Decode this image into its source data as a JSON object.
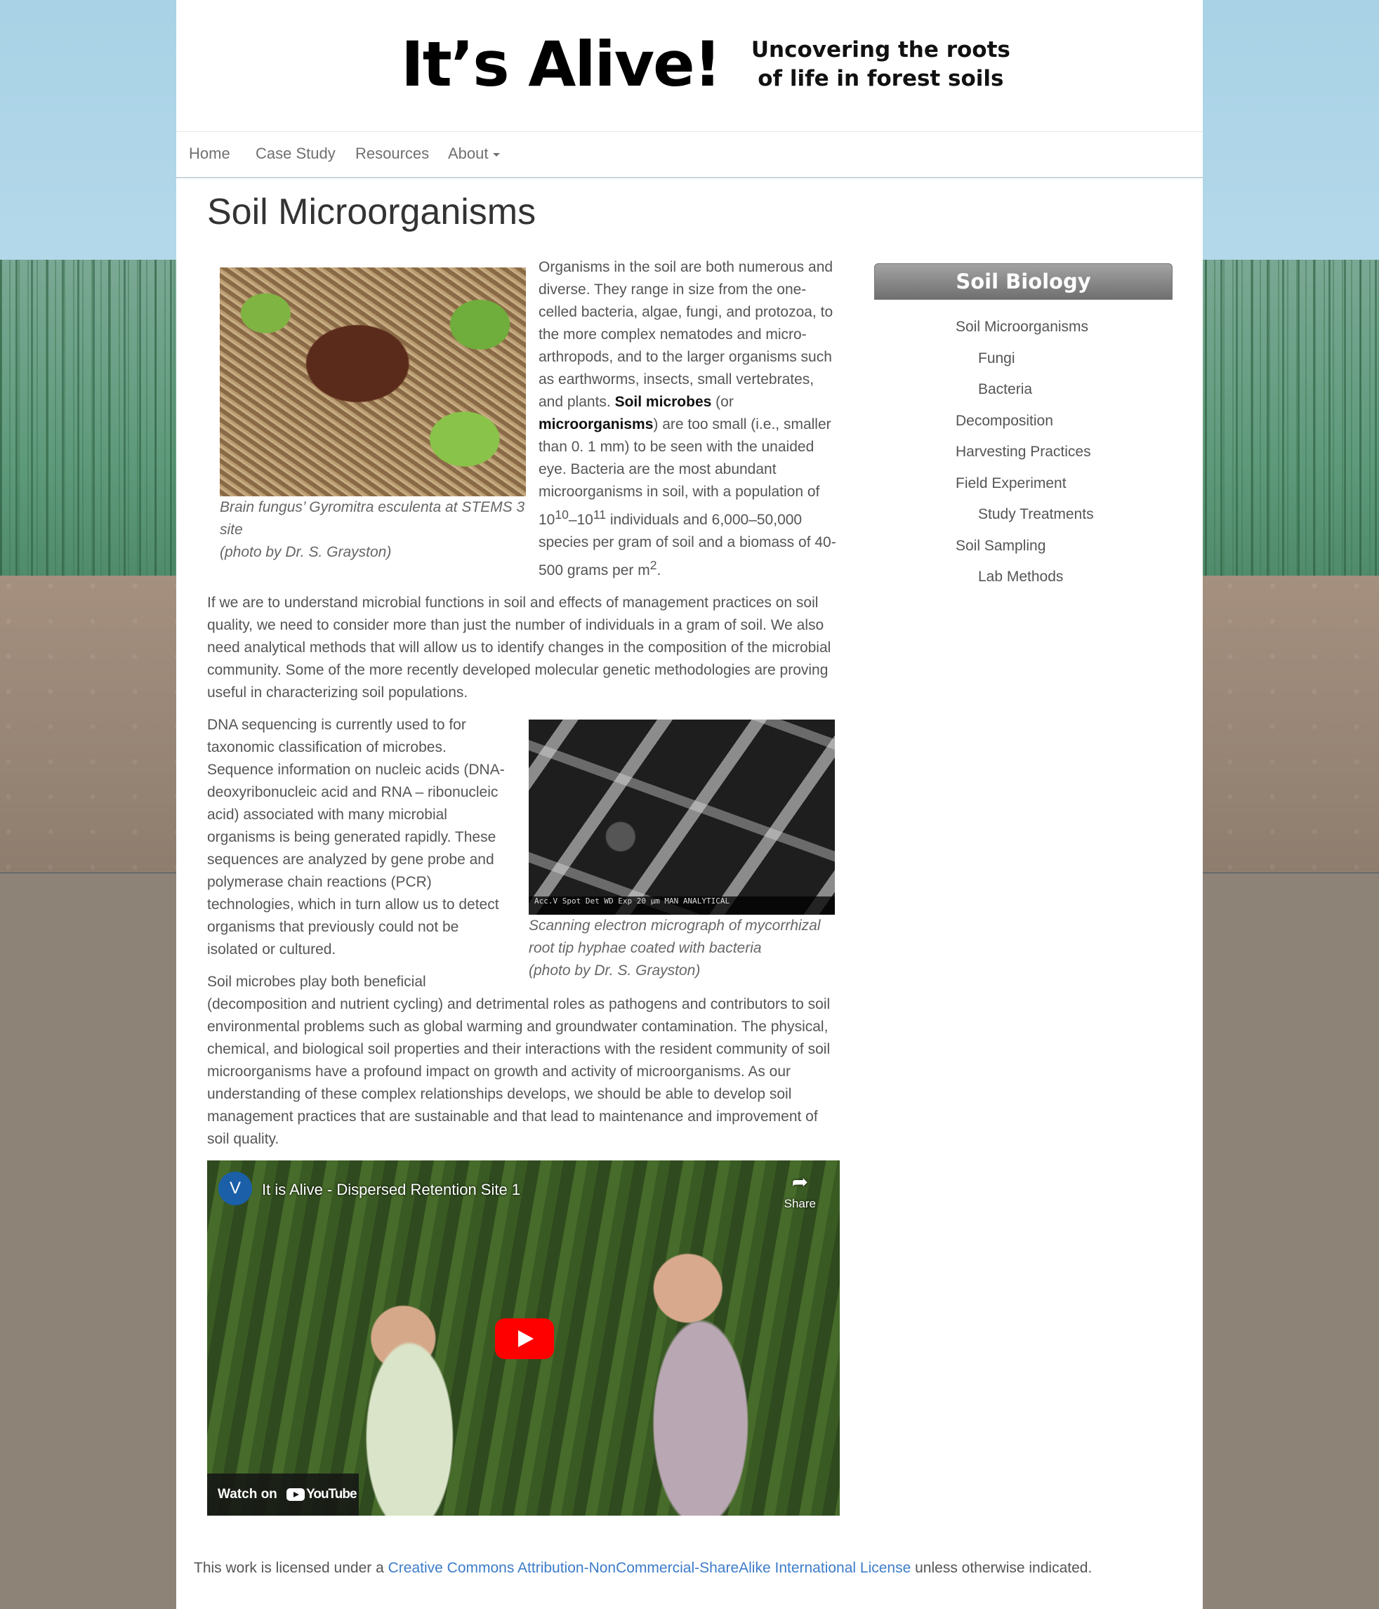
{
  "banner": {
    "title": "It’s Alive!",
    "tagline_line1": "Uncovering the roots",
    "tagline_line2": "of life in forest soils"
  },
  "nav": {
    "items": [
      {
        "label": "Home"
      },
      {
        "label": "Case Study"
      },
      {
        "label": "Resources"
      },
      {
        "label": "About"
      }
    ]
  },
  "page": {
    "title": "Soil Microorganisms"
  },
  "figures": {
    "morel": {
      "caption_line1": "Brain fungus’ Gyromitra esculenta at STEMS 3 site",
      "caption_line2": "(photo by Dr. S. Grayston)"
    },
    "sem": {
      "caption_line1": "Scanning electron micrograph of mycorrhizal root tip hyphae coated with bacteria",
      "caption_line2": "(photo by Dr. S. Grayston)",
      "overlay_text": "Acc.V  Spot Det  WD  Exp    20 μm    MAN ANALYTICAL"
    }
  },
  "article": {
    "p1_a": "Organisms in the soil are both numerous and diverse. They range in size from the one-celled bacteria, algae, fungi, and protozoa, to the more complex nematodes and micro-arthropods, and to the larger organisms such as earthworms, insects, small vertebrates, and plants.",
    "p1_bold1": "Soil microbes",
    "p1_b": "(or",
    "p1_bold2": "microorganisms",
    "p1_c": ") are too small (i.e., smaller than 0. 1 mm) to be seen with the unaided eye. Bacteria are the most abundant microorganisms in soil, with a population of 10",
    "p1_sup1": "10",
    "p1_d": "–10",
    "p1_sup2": "11",
    "p1_e": " individuals and 6,000–50,000 species per gram of soil and a biomass of 40-500 grams per m",
    "p1_sup3": "2",
    "p1_f": ".",
    "p2": "If we are to understand microbial functions in soil and effects of management practices on soil quality, we need to consider more than just the number of individuals in a gram of soil. We also need analytical methods that will allow us to identify changes in the composition of the microbial community. Some of the more recently developed molecular genetic methodologies are proving useful in characterizing soil populations.",
    "p3": "DNA sequencing is currently  used to for taxonomic classification of microbes. Sequence information on nucleic acids (DNA-deoxyribonucleic acid and RNA – ribonucleic acid) associated with many microbial organisms is being generated rapidly. These sequences are analyzed by gene probe and polymerase chain reactions (PCR) technologies, which in turn allow us to detect organisms that previously could not be isolated or cultured.",
    "p4": "Soil microbes play both beneficial (decomposition and nutrient cycling) and detrimental roles as pathogens and contributors to soil environmental problems such as global warming and groundwater contamination. The physical, chemical, and biological soil properties and their interactions with the resident community of soil microorganisms have a profound impact on growth and activity of microorganisms. As our understanding of these complex relationships develops, we should be able to develop soil management practices that are sustainable and that lead to maintenance and improvement of soil quality."
  },
  "video": {
    "channel_initial": "V",
    "title": "It is Alive - Dispersed Retention Site 1",
    "share_label": "Share",
    "watch_on": "Watch on",
    "youtube_word": "YouTube"
  },
  "sidebar": {
    "heading": "Soil Biology",
    "items": [
      {
        "label": "Soil Microorganisms",
        "level": 1
      },
      {
        "label": "Fungi",
        "level": 2
      },
      {
        "label": "Bacteria",
        "level": 2
      },
      {
        "label": "Decomposition",
        "level": 1
      },
      {
        "label": "Harvesting Practices",
        "level": 1
      },
      {
        "label": "Field Experiment",
        "level": 1
      },
      {
        "label": "Study Treatments",
        "level": 2
      },
      {
        "label": "Soil Sampling",
        "level": 1
      },
      {
        "label": "Lab Methods",
        "level": 2
      }
    ]
  },
  "footer": {
    "prefix": "This work is licensed under a ",
    "link": "Creative Commons Attribution-NonCommercial-ShareAlike International License",
    "suffix": " unless otherwise indicated."
  },
  "colors": {
    "link": "#3d7cc9",
    "sky": "#a9d2e6",
    "soil": "#8e8377",
    "play_button": "#ff0000"
  }
}
